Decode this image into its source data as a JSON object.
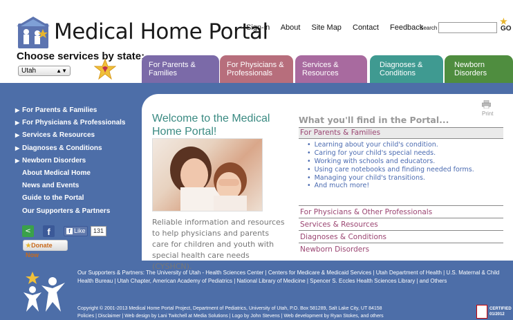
{
  "header": {
    "logo_text": "Medical Home Portal",
    "choose_label": "Choose services by state:",
    "state_value": "Utah",
    "top_nav": [
      "Sign-in",
      "About",
      "Site Map",
      "Contact",
      "Feedback"
    ],
    "search_label": "Search",
    "go_label": "GO"
  },
  "tabs": [
    {
      "label": "For Parents & Families",
      "color": "#7b6aa8"
    },
    {
      "label": "For Physicians & Professionals",
      "color": "#b76e7c"
    },
    {
      "label": "Services & Resources",
      "color": "#a86a9f"
    },
    {
      "label": "Diagnoses & Conditions",
      "color": "#3f9a91"
    },
    {
      "label": "Newborn Disorders",
      "color": "#4f8d3f"
    }
  ],
  "sidebar": {
    "expandable": [
      "For Parents & Families",
      "For Physicians & Professionals",
      "Services & Resources",
      "Diagnoses & Conditions",
      "Newborn Disorders"
    ],
    "links": [
      "About Medical Home",
      "News and Events",
      "Guide to the Portal",
      "Our Supporters & Partners"
    ],
    "like_label": "Like",
    "like_count": "131",
    "donate_label": "Donate Now"
  },
  "main": {
    "welcome_title": "Welcome to the Medical Home Portal!",
    "intro": "Reliable information and resources to help physicians and parents care for children and youth with special health care needs (CYSHCN).",
    "print_label": "Print",
    "find_heading": "What you'll find in the Portal...",
    "parents_heading": "For Parents & Families",
    "parents_items": [
      "Learning about your child's condition.",
      "Caring for your child's special needs.",
      "Working with schools and educators.",
      "Using care notebooks and finding needed forms.",
      "Managing your child's transitions.",
      "And much more!"
    ],
    "other_sections": [
      "For Physicians & Other Professionals",
      "Services & Resources",
      "Diagnoses & Conditions",
      "Newborn Disorders"
    ]
  },
  "footer": {
    "partners": "Our Supporters & Partners: The University of Utah - Health Sciences Center | Centers for Medicare & Medicaid Services | Utah Department of Health | U.S. Maternal & Child Health Bureau | Utah Chapter, American Academy of Pediatrics | National Library of Medicine | Spencer S. Eccles Health Sciences Library | and Others",
    "copyright_line1": "Copyright © 2001-2013 Medical Home Portal Project, Department of Pediatrics, University of Utah, P.O. Box 581289, Salt Lake City, UT 84158",
    "copyright_line2": "Policies | Disclaimer | Web design by Lani Twitchell at Media Solutions | Logo by John Stevens | Web development by Ryan Stokes, and others",
    "certified_label": "CERTIFIED",
    "certified_date": "01/2012"
  },
  "colors": {
    "body_blue": "#4d6ea8",
    "teal_text": "#3a8a82",
    "section_text": "#9a4471",
    "link_blue": "#4a6ab0"
  }
}
